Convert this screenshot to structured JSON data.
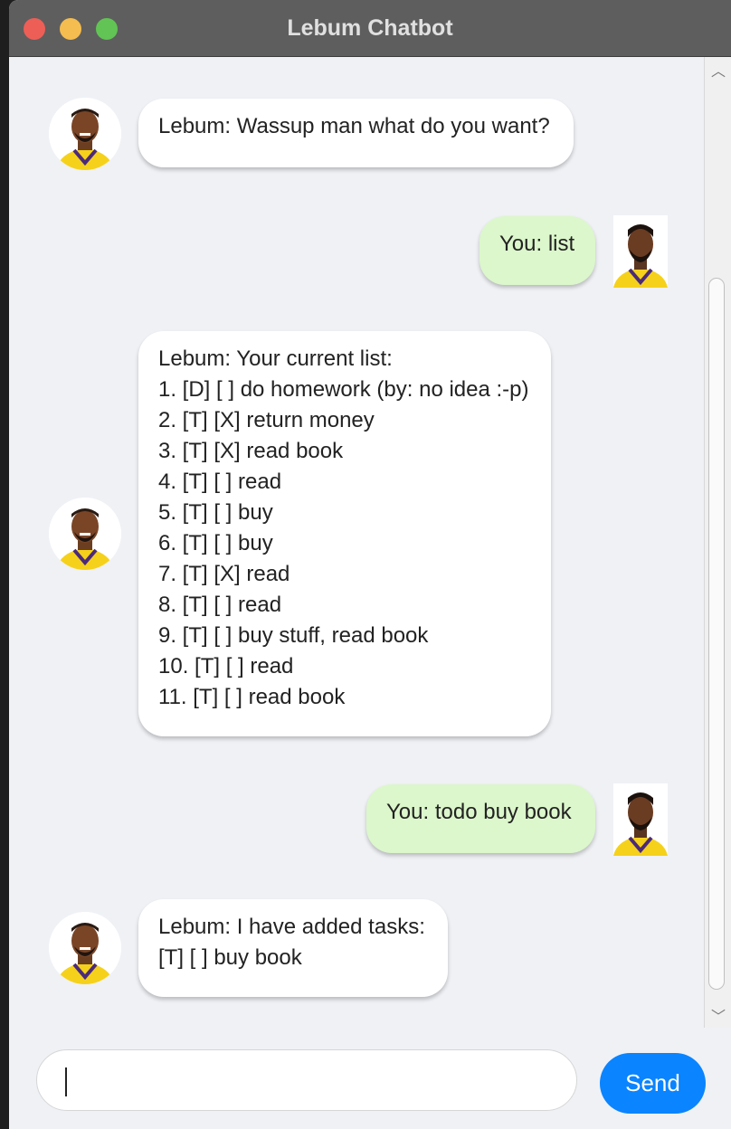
{
  "window": {
    "title": "Lebum Chatbot"
  },
  "messages": [
    {
      "sender": "bot",
      "text": "Lebum: Wassup man what do you want?"
    },
    {
      "sender": "user",
      "text": "You: list"
    },
    {
      "sender": "bot",
      "text": "Lebum: Your current list:\n1. [D] [ ] do homework (by: no idea :-p)\n2. [T] [X] return money\n3. [T] [X] read book\n4. [T] [ ] read\n5. [T] [ ] buy\n6. [T] [ ] buy\n7. [T] [X] read\n8. [T] [ ] read\n9. [T] [ ] buy stuff, read book\n10. [T] [ ] read\n11. [T] [ ] read book"
    },
    {
      "sender": "user",
      "text": "You: todo buy book"
    },
    {
      "sender": "bot",
      "text": "Lebum: I have added tasks:\n[T] [ ] buy book"
    }
  ],
  "input": {
    "value": "",
    "placeholder": ""
  },
  "send_label": "Send",
  "colors": {
    "bot_bubble": "#ffffff",
    "user_bubble": "#dcf7cb",
    "send_button": "#0a84ff",
    "titlebar": "#5e5e5e"
  }
}
